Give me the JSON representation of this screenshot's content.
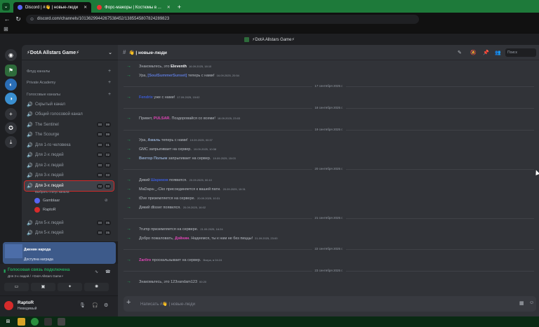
{
  "browser": {
    "tabs": [
      {
        "label": "Discord | #👋 | новые-люди",
        "active": true
      },
      {
        "label": "Форс-мажоры | Костюмы в ...",
        "active": false
      }
    ],
    "new_tab": "+",
    "url": "discord.com/channels/1013629944267538452/1385545807824289823",
    "bookmarks_icon": "grid-icon"
  },
  "discord": {
    "title": "⚡DotA Allstars Game⚡",
    "server": {
      "name": "⚡DotA Allstars Game⚡",
      "categories": [
        {
          "label": "Флуд каналы",
          "plus": "+"
        },
        {
          "label": "Private Academy",
          "plus": "+"
        },
        {
          "label": "Голосовые каналы",
          "plus": "+"
        }
      ],
      "voice_channels": [
        {
          "label": "Скрытый канал",
          "badges": []
        },
        {
          "label": "Общий голосовой канал",
          "badges": []
        },
        {
          "label": "The Sentinel",
          "badges": [
            "00",
            "99"
          ]
        },
        {
          "label": "The Scourge",
          "badges": [
            "00",
            "99"
          ]
        },
        {
          "label": "Для 1-го человека",
          "badges": [
            "00",
            "01"
          ]
        },
        {
          "label": "Для 2-х людей",
          "badges": [
            "00",
            "02"
          ]
        },
        {
          "label": "Для 2-х людей",
          "badges": [
            "00",
            "02"
          ]
        },
        {
          "label": "Для 3-х людей",
          "badges": [
            "00",
            "03"
          ]
        },
        {
          "label": "Для 3-х людей",
          "badges": [
            "02",
            "03"
          ]
        },
        {
          "label": "Для 5-х людей",
          "badges": [
            "00",
            "05"
          ]
        },
        {
          "label": "Для 5-х людей",
          "badges": [
            "00",
            "05"
          ]
        }
      ],
      "status_hint": "Выбрать статус канала",
      "members": [
        {
          "name": "Gamblaar"
        },
        {
          "name": "RaptoR"
        }
      ]
    },
    "activity": {
      "title": "Дженин народа",
      "subtitle": "Доступна награда"
    },
    "voice_panel": {
      "status": "Голосовая связь подключена",
      "sub": "Для 3-х людей / ⚡DotA Allstars Game⚡"
    },
    "user": {
      "name": "RaptoR",
      "status": "Невидимый"
    },
    "channel": {
      "name": "👋 | новые-люди",
      "search_placeholder": "Поиск"
    },
    "messages": [
      {
        "text": "Знакомьтесь, это ",
        "name": "Eleventh",
        "ts": "16.09.2025, 18:10"
      },
      {
        "text": "Ура, ",
        "name": "[SoulSummerSunset]",
        "rest": " теперь с нами!",
        "ts": "16.09.2025, 20:54"
      },
      {
        "divider": "17 сентября 2025 г."
      },
      {
        "text": "",
        "name": "Fendrix",
        "rest": " уже с нами!",
        "ts": "17.09.2025, 15:02"
      },
      {
        "divider": "18 сентября 2025 г."
      },
      {
        "text": "Привет, ",
        "name": "PULSAR.",
        "rest": " Поздоровайся со всеми!",
        "ts": "18.09.2025, 23:03"
      },
      {
        "divider": "19 сентября 2025 г."
      },
      {
        "text": "Ура, ",
        "name": "Амаль",
        "rest": " теперь с нами!",
        "ts": "19.09.2025, 00:37"
      },
      {
        "text": "",
        "name": "GMC",
        "rest": " запрыгивает на сервер.",
        "ts": "19.09.2025, 10:38"
      },
      {
        "text": "",
        "name": "Виктор Полым",
        "rest": " запрыгивает на сервер.",
        "ts": "19.09.2025, 15:03"
      },
      {
        "divider": "20 сентября 2025 г."
      },
      {
        "text": "Дикий ",
        "name": "Шариков",
        "rest": " появился.",
        "ts": "20.09.2025, 00:10"
      },
      {
        "text": "",
        "name": "MaDapa-_-Cko",
        "rest": " присоединяется к вашей пати.",
        "ts": "20.09.2025, 10:31"
      },
      {
        "text": "",
        "name": "tDve",
        "rest": " приземляется на сервере.",
        "ts": "20.09.2025, 10:31"
      },
      {
        "text": "Дикий ",
        "name": "dlisser",
        "rest": " появился.",
        "ts": "20.09.2025, 16:02"
      },
      {
        "divider": "21 сентября 2025 г."
      },
      {
        "text": "",
        "name": "?rump",
        "rest": " приземляется на сервере.",
        "ts": "21.09.2025, 16:24"
      },
      {
        "text": "Добро пожаловать, ",
        "name": "Дэйнин",
        "rest": ". Надеемся, ты к нам не без пиццы!",
        "ts": "21.09.2025, 23:00"
      },
      {
        "divider": "22 сентября 2025 г."
      },
      {
        "text": "",
        "name": "Zarilro",
        "rest": " проскальзывает на сервер.",
        "ts": "Вчера, в 04:24"
      },
      {
        "divider": "23 сентября 2025 г."
      },
      {
        "text": "Знакомьтесь, это ",
        "name": "123vandam123",
        "rest": "",
        "ts": "00:20"
      }
    ],
    "composer_placeholder": "Написать #👋 | новые-люди"
  },
  "colors": {
    "accent": "#23a55a",
    "selected_outline": "#d32a2a",
    "chrome_green": "#1e7a3a"
  }
}
